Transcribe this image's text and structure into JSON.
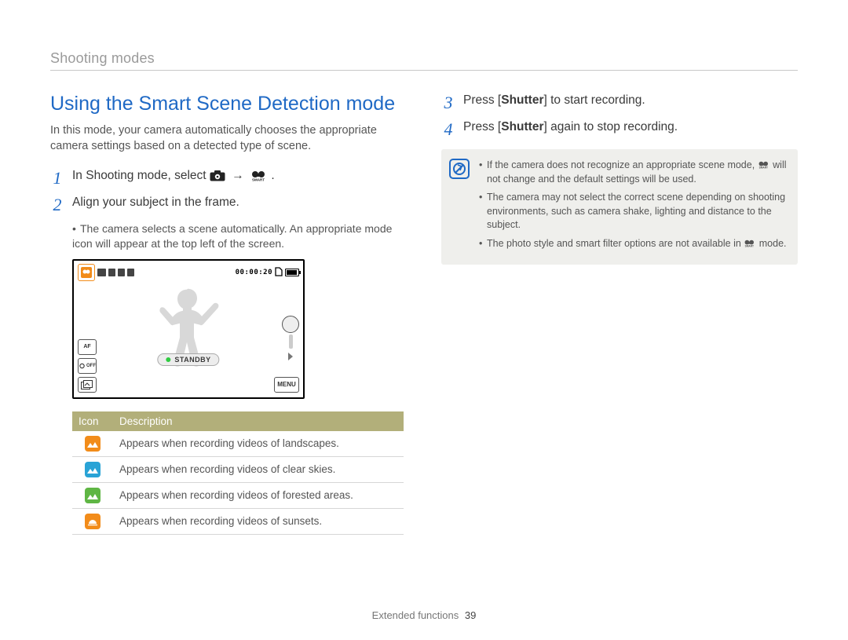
{
  "header": {
    "section": "Shooting modes"
  },
  "left": {
    "title": "Using the Smart Scene Detection mode",
    "intro": "In this mode, your camera automatically chooses the appropriate camera settings based on a detected type of scene.",
    "step1": {
      "num": "1",
      "prefix": "In Shooting mode, select ",
      "arrow": "→",
      "suffix": "."
    },
    "step2": {
      "num": "2",
      "text": "Align your subject in the frame.",
      "sub": "The camera selects a scene automatically. An appropriate mode icon will appear at the top left of the screen."
    },
    "preview": {
      "timecode": "00:00:20",
      "standby": "STANDBY",
      "menu": "MENU",
      "af": "AF",
      "off": "OFF"
    },
    "table": {
      "head_icon": "Icon",
      "head_desc": "Description",
      "rows": [
        {
          "desc": "Appears when recording videos of landscapes."
        },
        {
          "desc": "Appears when recording videos of clear skies."
        },
        {
          "desc": "Appears when recording videos of forested areas."
        },
        {
          "desc": "Appears when recording videos of sunsets."
        }
      ]
    }
  },
  "right": {
    "step3": {
      "num": "3",
      "pre": "Press [",
      "key": "Shutter",
      "post": "] to start recording."
    },
    "step4": {
      "num": "4",
      "pre": "Press [",
      "key": "Shutter",
      "post": "] again to stop recording."
    },
    "notes": {
      "n1_pre": "If the camera does not recognize an appropriate scene mode, ",
      "n1_post": " will not change and the default settings will be used.",
      "n2": "The camera may not select the correct scene depending on shooting environments, such as camera shake, lighting and distance to the subject.",
      "n3_pre": "The photo style and smart filter options are not available in ",
      "n3_post": " mode."
    }
  },
  "footer": {
    "label": "Extended functions",
    "page": "39"
  }
}
